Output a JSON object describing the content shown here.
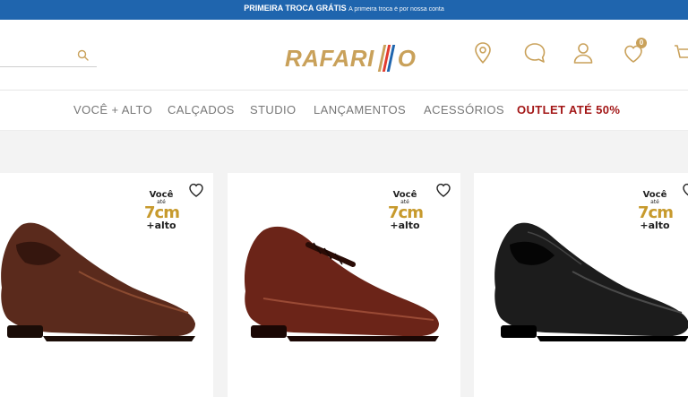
{
  "promo": {
    "title": "PRIMEIRA TROCA GRÁTIS",
    "subtitle": "A primeira troca é por nossa conta"
  },
  "brand": {
    "logo_part1": "RAFARI",
    "logo_part2": "O",
    "gold": "#c9a15a",
    "red": "#e23b2f",
    "blue": "#1f65ae"
  },
  "header": {
    "search_placeholder": "",
    "wishlist_count": "0"
  },
  "nav": {
    "items": [
      "VOCÊ + ALTO",
      "CALÇADOS",
      "STUDIO",
      "LANÇAMENTOS",
      "ACESSÓRIOS"
    ],
    "outlet": "OUTLET ATÉ 50%",
    "outlet_color": "#a31717"
  },
  "products": [
    {
      "badge": {
        "l1": "Você",
        "l2": "até",
        "l3": "7cm",
        "l4": "+alto"
      },
      "shoe_color": "#5a2a1c",
      "style": "slip-on"
    },
    {
      "badge": {
        "l1": "Você",
        "l2": "até",
        "l3": "7cm",
        "l4": "+alto"
      },
      "shoe_color": "#6b2418",
      "style": "lace-up"
    },
    {
      "badge": {
        "l1": "Você",
        "l2": "até",
        "l3": "7cm",
        "l4": "+alto"
      },
      "shoe_color": "#1c1c1c",
      "style": "slip-on"
    }
  ],
  "icons": [
    "search-icon",
    "location-pin-icon",
    "chat-bubble-icon",
    "user-icon",
    "heart-icon",
    "cart-icon"
  ]
}
